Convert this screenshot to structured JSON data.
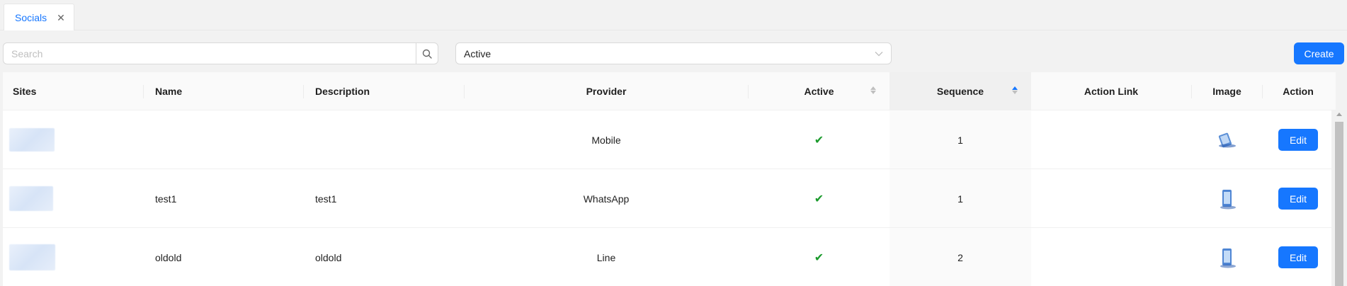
{
  "tabs": [
    {
      "label": "Socials",
      "close_icon": "close-icon"
    }
  ],
  "toolbar": {
    "search_placeholder": "Search",
    "search_value": "",
    "status_select": "Active",
    "create_label": "Create"
  },
  "table": {
    "columns": [
      "Sites",
      "Name",
      "Description",
      "Provider",
      "Active",
      "Sequence",
      "Action Link",
      "Image",
      "Action"
    ],
    "sorted_column": "Sequence",
    "rows": [
      {
        "site": "",
        "name": "",
        "description": "",
        "provider": "Mobile",
        "active": "✔",
        "sequence": "1",
        "action_link": "",
        "image": "mobile-phone-icon",
        "action": "Edit"
      },
      {
        "site": "",
        "name": "test1",
        "description": "test1",
        "provider": "WhatsApp",
        "active": "✔",
        "sequence": "1",
        "action_link": "",
        "image": "mobile-phone-icon",
        "action": "Edit"
      },
      {
        "site": "",
        "name": "oldold",
        "description": "oldold",
        "provider": "Line",
        "active": "✔",
        "sequence": "2",
        "action_link": "",
        "image": "mobile-phone-icon",
        "action": "Edit"
      }
    ]
  },
  "colors": {
    "primary": "#1677ff",
    "active_check": "#1a9a2c"
  }
}
